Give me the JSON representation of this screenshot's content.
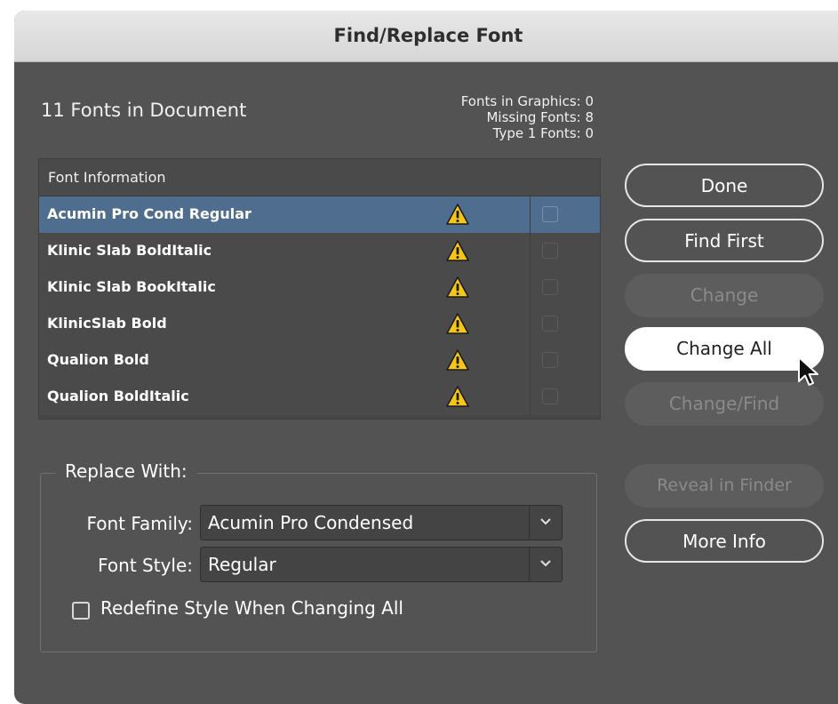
{
  "dialog": {
    "title": "Find/Replace Font"
  },
  "summary": {
    "doc_fonts": "11 Fonts in Document",
    "fonts_in_graphics": "Fonts in Graphics: 0",
    "missing_fonts": "Missing Fonts: 8",
    "type1_fonts": "Type 1 Fonts: 0"
  },
  "font_list": {
    "header": "Font Information",
    "rows": [
      {
        "name": "Acumin Pro Cond Regular",
        "status_icon": "warning-icon",
        "selected": true,
        "checked": false
      },
      {
        "name": "Klinic Slab BoldItalic",
        "status_icon": "warning-icon",
        "selected": false,
        "checked": false
      },
      {
        "name": "Klinic Slab BookItalic",
        "status_icon": "warning-icon",
        "selected": false,
        "checked": false
      },
      {
        "name": "KlinicSlab Bold",
        "status_icon": "warning-icon",
        "selected": false,
        "checked": false
      },
      {
        "name": "Qualion Bold",
        "status_icon": "warning-icon",
        "selected": false,
        "checked": false
      },
      {
        "name": "Qualion BoldItalic",
        "status_icon": "warning-icon",
        "selected": false,
        "checked": false
      }
    ]
  },
  "buttons": {
    "done": "Done",
    "find_first": "Find First",
    "change": "Change",
    "change_all": "Change All",
    "change_find": "Change/Find",
    "reveal_in_finder": "Reveal in Finder",
    "more_info": "More Info"
  },
  "replace_with": {
    "title": "Replace With:",
    "font_family_label": "Font Family:",
    "font_family_value": "Acumin Pro Condensed",
    "font_style_label": "Font Style:",
    "font_style_value": "Regular",
    "redefine_label": "Redefine Style When Changing All",
    "redefine_checked": false
  },
  "colors": {
    "dialog_bg": "#535353",
    "selection": "#4f6d8f",
    "warning": "#f5c518"
  }
}
